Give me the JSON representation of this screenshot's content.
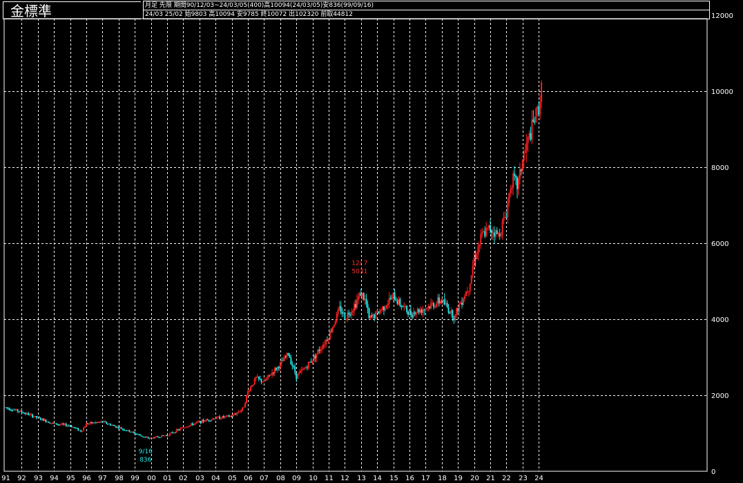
{
  "header": {
    "instrument": "金標準",
    "line1": "月足  先限  期間90/12/03~24/03/05(400)高10094(24/03/05)安836(99/09/16)",
    "line2": "24/03 25/02 始9803 高10094 安9785 終10072 出102320 前取44812"
  },
  "colors": {
    "background": "#000000",
    "up": "#ff2020",
    "down": "#20e8e8",
    "grid": "#ffffff",
    "text": "#ffffff",
    "high_marker": "#ff3030",
    "low_marker": "#20e8e8"
  },
  "chart_data": {
    "type": "candlestick",
    "title": "金標準",
    "period": "月足",
    "ylim": [
      0,
      12000
    ],
    "y_ticks": [
      0,
      2000,
      4000,
      6000,
      8000,
      10000,
      12000
    ],
    "x_ticks": [
      "91",
      "92",
      "93",
      "94",
      "95",
      "96",
      "97",
      "98",
      "99",
      "00",
      "01",
      "02",
      "03",
      "04",
      "05",
      "06",
      "07",
      "08",
      "09",
      "10",
      "11",
      "12",
      "13",
      "14",
      "15",
      "16",
      "17",
      "18",
      "19",
      "20",
      "21",
      "22",
      "23",
      "24"
    ],
    "grid": "dashed",
    "annotations": [
      {
        "label": "9/16",
        "value": "836",
        "year": "99",
        "month": 9,
        "kind": "low"
      },
      {
        "label": "12/ 7",
        "value": "5031",
        "year": "12",
        "month": 12,
        "kind": "high"
      }
    ],
    "series_anchors": [
      [
        "91",
        1680
      ],
      [
        "92",
        1560
      ],
      [
        "93",
        1400
      ],
      [
        "94",
        1250
      ],
      [
        "95",
        1200
      ],
      [
        "95.7",
        1050
      ],
      [
        "96",
        1250
      ],
      [
        "97",
        1300
      ],
      [
        "98",
        1150
      ],
      [
        "99",
        1000
      ],
      [
        "99.7",
        880
      ],
      [
        "00",
        870
      ],
      [
        "01",
        950
      ],
      [
        "02",
        1150
      ],
      [
        "03",
        1300
      ],
      [
        "04",
        1400
      ],
      [
        "05",
        1450
      ],
      [
        "05.7",
        1650
      ],
      [
        "06",
        2100
      ],
      [
        "06.5",
        2450
      ],
      [
        "07",
        2350
      ],
      [
        "07.5",
        2600
      ],
      [
        "08",
        2800
      ],
      [
        "08.5",
        3100
      ],
      [
        "09",
        2500
      ],
      [
        "09.5",
        2700
      ],
      [
        "10",
        2950
      ],
      [
        "11",
        3550
      ],
      [
        "11.7",
        4300
      ],
      [
        "12",
        4050
      ],
      [
        "12.5",
        4300
      ],
      [
        "13",
        4700
      ],
      [
        "13.3",
        4450
      ],
      [
        "13.5",
        4000
      ],
      [
        "14",
        4150
      ],
      [
        "15",
        4600
      ],
      [
        "16",
        4150
      ],
      [
        "17",
        4300
      ],
      [
        "18",
        4500
      ],
      [
        "18.8",
        4050
      ],
      [
        "19",
        4300
      ],
      [
        "19.7",
        4900
      ],
      [
        "20",
        5600
      ],
      [
        "20.5",
        6200
      ],
      [
        "21",
        6400
      ],
      [
        "21.5",
        6200
      ],
      [
        "22",
        6800
      ],
      [
        "22.3",
        7700
      ],
      [
        "22.7",
        7500
      ],
      [
        "23",
        8200
      ],
      [
        "23.5",
        8900
      ],
      [
        "24",
        9600
      ],
      [
        "24.2",
        10072
      ]
    ],
    "last_bar": {
      "date": "24/03",
      "open": 9803,
      "high": 10094,
      "low": 9785,
      "close": 10072
    }
  }
}
